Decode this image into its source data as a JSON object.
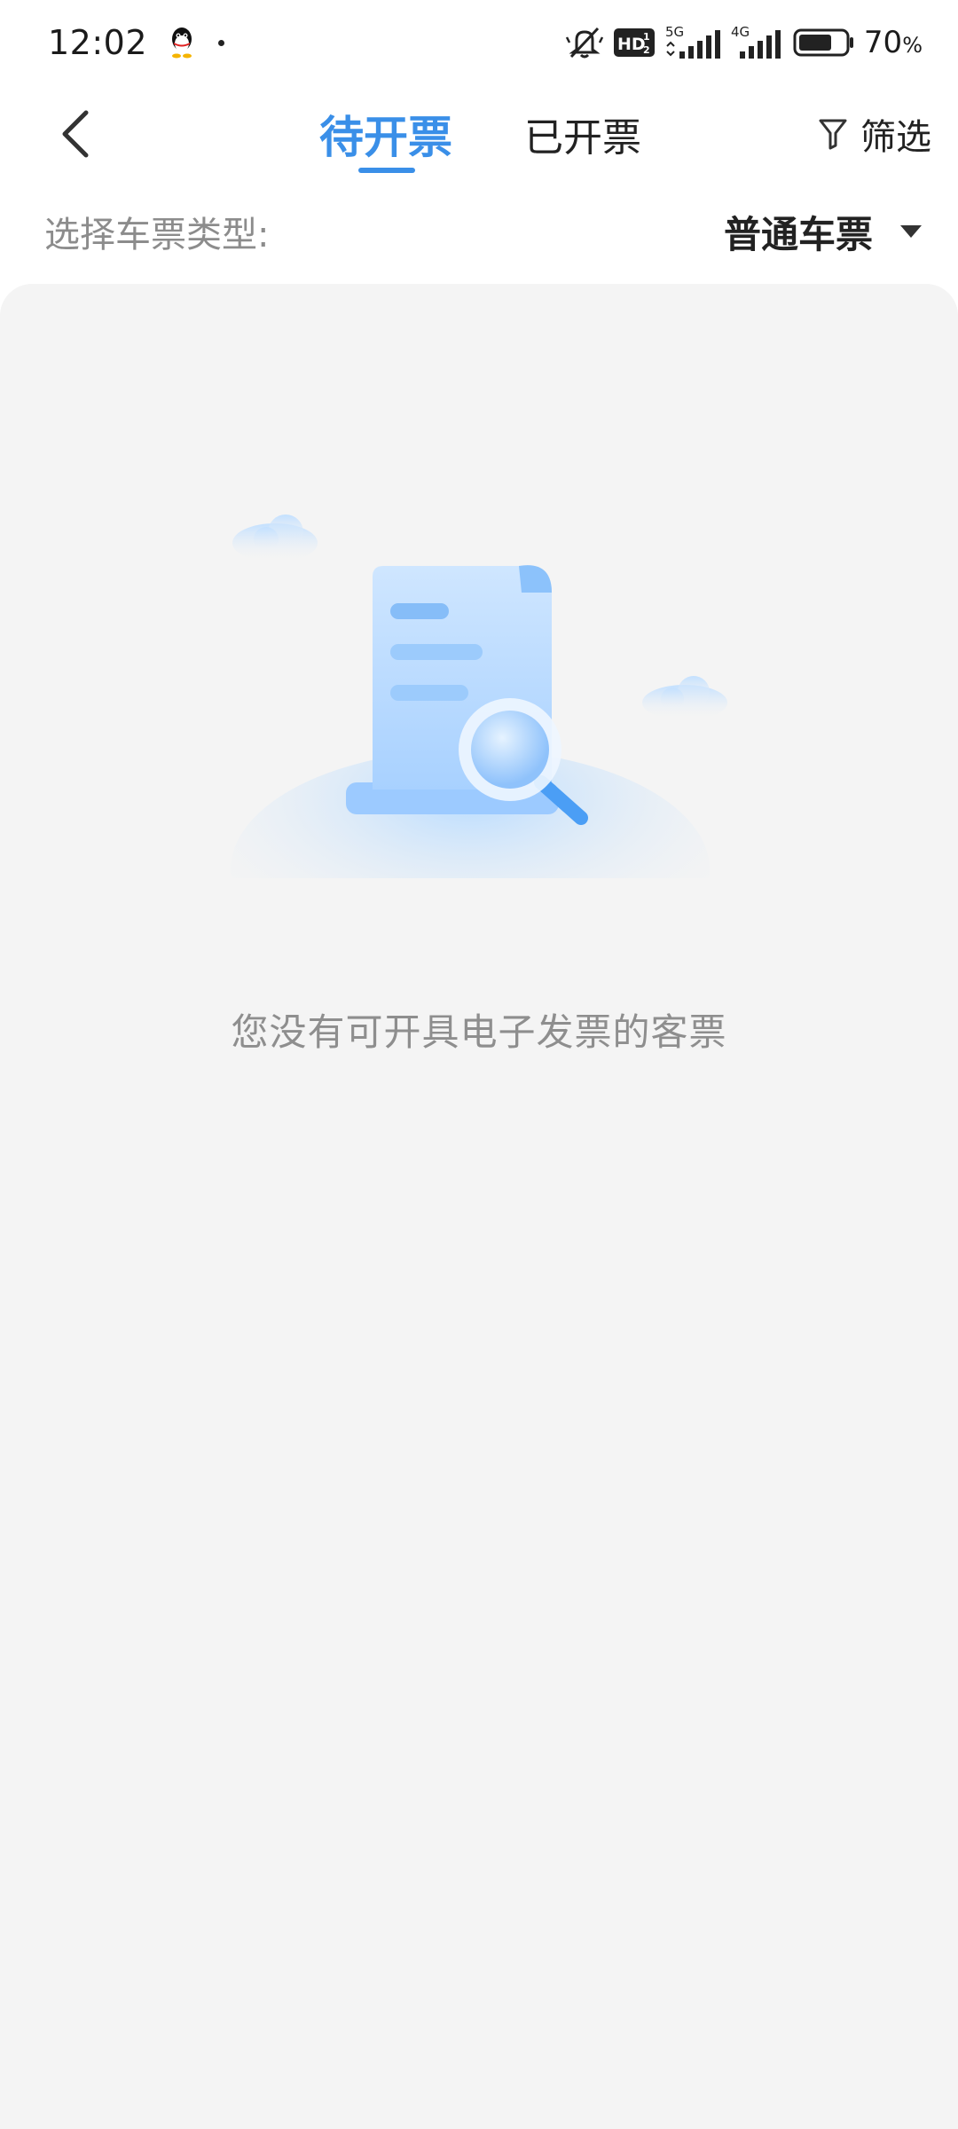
{
  "status_bar": {
    "time": "12:02",
    "signal_5g": "5G",
    "signal_4g": "4G",
    "hd": "HD",
    "battery_percent": "70",
    "battery_unit": "%"
  },
  "nav": {
    "tabs": [
      {
        "label": "待开票",
        "active": true
      },
      {
        "label": "已开票",
        "active": false
      }
    ],
    "filter_label": "筛选",
    "accent_color": "#3a8fe8"
  },
  "ticket_type": {
    "label": "选择车票类型:",
    "selected": "普通车票"
  },
  "empty_state": {
    "message": "您没有可开具电子发票的客票"
  }
}
